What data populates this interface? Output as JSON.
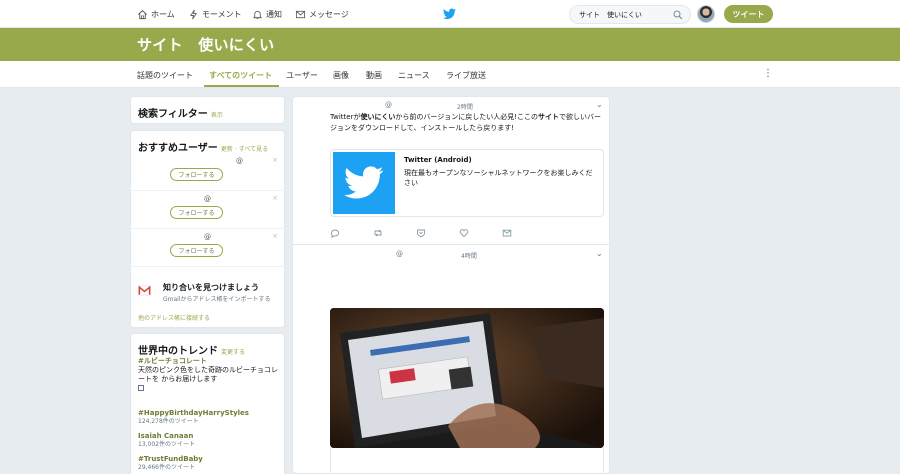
{
  "topnav": {
    "home_label": "ホーム",
    "moments_label": "モーメント",
    "notifications_label": "通知",
    "messages_label": "メッセージ",
    "search_value": "サイト　使いにくい",
    "tweet_button": "ツイート"
  },
  "banner": {
    "title": "サイト　使いにくい"
  },
  "tabs": [
    {
      "label": "話題のツイート"
    },
    {
      "label": "すべてのツイート",
      "active": true
    },
    {
      "label": "ユーザー"
    },
    {
      "label": "画像"
    },
    {
      "label": "動画"
    },
    {
      "label": "ニュース"
    },
    {
      "label": "ライブ放送"
    }
  ],
  "search_filter": {
    "title": "検索フィルター",
    "show_link": "表示"
  },
  "recommended": {
    "title": "おすすめユーザー",
    "update_link": "更新",
    "separator": "·",
    "see_all_link": "すべて見る",
    "users": [
      {
        "handle": "@",
        "follow_label": "フォローする",
        "close": "×"
      },
      {
        "handle": "@",
        "follow_label": "フォローする",
        "close": "×"
      },
      {
        "handle": "@",
        "follow_label": "フォローする",
        "close": "×"
      }
    ],
    "gmail": {
      "title": "知り合いを見つけましょう",
      "subtitle": "Gmailからアドレス帳をインポートする"
    },
    "other_addressbook_link": "他のアドレス帳に接続する"
  },
  "trends": {
    "title": "世界中のトレンド",
    "change_link": "変更する",
    "items": [
      {
        "tag": "#ルビーチョコレート",
        "desc": "天然のピンク色をした奇跡のルビーチョコレートを からお届けします",
        "count": ""
      },
      {
        "tag": "#HappyBirthdayHarryStyles",
        "desc": "",
        "count": "124,278件のツイート"
      },
      {
        "tag": "Isaiah Canaan",
        "desc": "",
        "count": "13,002件のツイート"
      },
      {
        "tag": "#TrustFundBaby",
        "desc": "",
        "count": "29,466件のツイート"
      }
    ]
  },
  "tweets": [
    {
      "handle": "@",
      "time": "2時間",
      "text_pre": "Twitterが",
      "text_bold": "使いにくい",
      "text_mid": "から前のバージョンに戻したい人必見!ここの",
      "text_bold2": "サイト",
      "text_post": "で欲しいバージョンをダウンロードして、インストールしたら戻ります!",
      "card": {
        "title": "Twitter (Android)",
        "desc": "現在最もオープンなソーシャルネットワークをお楽しみください"
      }
    },
    {
      "handle": "@",
      "time": "4時間"
    }
  ],
  "colors": {
    "accent": "#97a94b",
    "twitter_blue": "#1da1f2",
    "background": "#e6ecf0"
  },
  "icons": [
    "home-icon",
    "moments-icon",
    "bell-icon",
    "envelope-icon",
    "twitter-bird-icon",
    "search-icon",
    "reply-icon",
    "retweet-icon",
    "pocket-icon",
    "heart-icon",
    "dm-icon",
    "gmail-icon"
  ]
}
